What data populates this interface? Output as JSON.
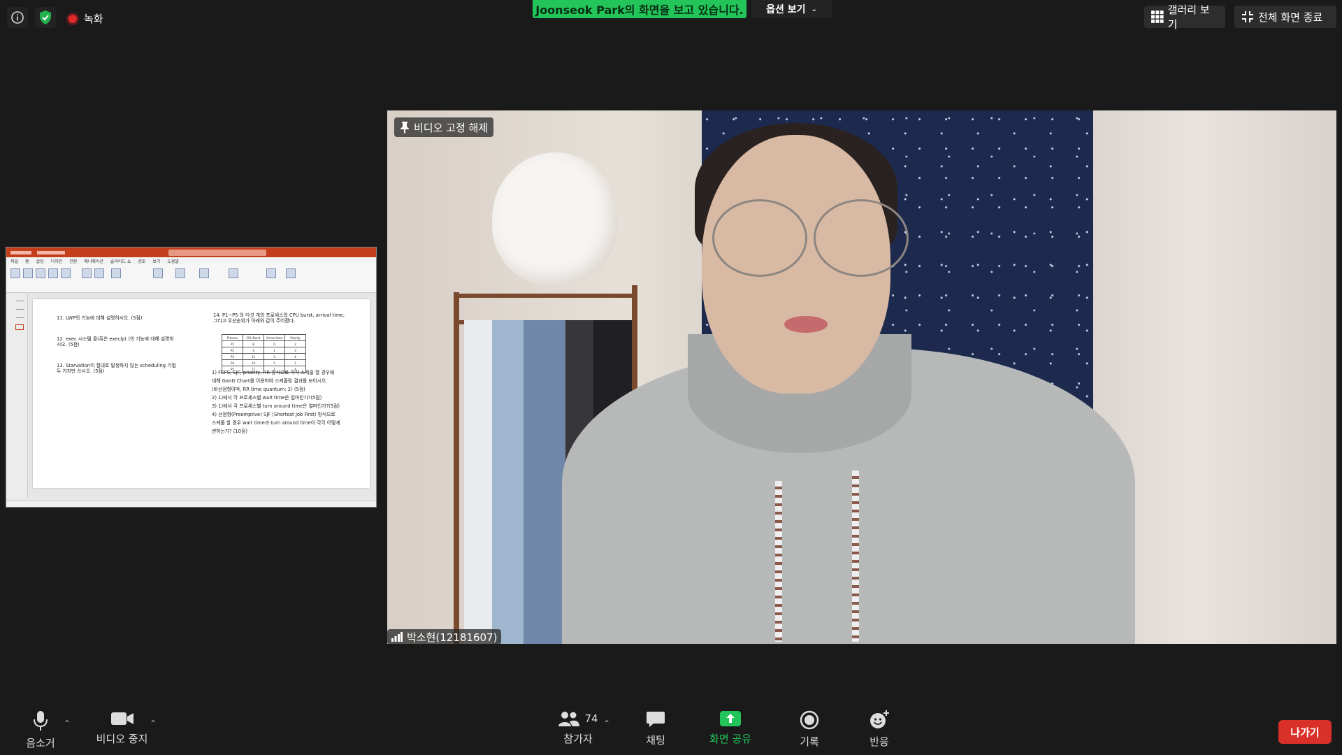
{
  "top_bar": {
    "recording_label": "녹화",
    "share_banner": "Joonseok  Park의 화면을 보고 있습니다.",
    "view_options_label": "옵션 보기",
    "gallery_view_label": "갤러리 보기",
    "exit_fullscreen_label": "전체 화면 종료"
  },
  "shared_screen": {
    "ribbon_tabs": [
      "파일",
      "홈",
      "삽입",
      "디자인",
      "전환",
      "애니메이션",
      "슬라이드 쇼",
      "검토",
      "보기",
      "도움말"
    ],
    "slide_lines": [
      "11. LWP의 기능에 대해 설명하시오. (5점)",
      "12. exec 시스템 콜(혹은  execlp( )의 기능에 대해 설명하",
      "시오. (5점)",
      "13. Starvation이 절대로 발생하지 않는 scheduling 기법",
      "두 가지만 쓰시오. (5점)",
      "14. P1~P5 의 다섯 개의 프로세스의 CPU burst, arrival time,",
      "그리고 우선순위가 아래와 같이 주어졌다.",
      "1) FCFS, SJF, priority, RR 방식으로 각각 스케줄 할 경우에",
      "대해 Gantt Chart를 이용하여 스케줄링 결과를 보이시오.",
      "(비선점형이며, RR time quantum: 2) (5점)",
      "2) 1)에서 각 프로세스별 wait time은 얼마인가?(5점)",
      "3) 1)에서 각 프로세스별 turn around time은 얼마인가?(5점)",
      "4) 선점형(Preemptive) SJF (Shortest Job First) 방식으로",
      "스케줄 할 경우 wait time과 turn around time이 각각 어떻게",
      "변하는가? (10점)"
    ],
    "table_headers": [
      "Process",
      "CPU Burst",
      "Arrival time",
      "Priority"
    ],
    "table_rows": [
      [
        "P1",
        "8",
        "0",
        "2"
      ],
      [
        "P2",
        "3",
        "1",
        "3"
      ],
      [
        "P3",
        "11",
        "3",
        "4"
      ],
      [
        "P4",
        "10",
        "5",
        "1"
      ],
      [
        "P5",
        "17",
        "7",
        "4"
      ]
    ]
  },
  "video": {
    "unpin_label": "비디오 고정 해제",
    "participant_name": "박소현(12181607)"
  },
  "toolbar": {
    "mute_label": "음소거",
    "stop_video_label": "비디오 중지",
    "participants_label": "참가자",
    "participants_count": "74",
    "chat_label": "채팅",
    "share_label": "화면 공유",
    "record_label": "기록",
    "reactions_label": "반응",
    "leave_label": "나가기"
  },
  "colors": {
    "share_green": "#23c55b",
    "leave_red": "#d9302a",
    "powerpoint_red": "#c43e1c"
  }
}
